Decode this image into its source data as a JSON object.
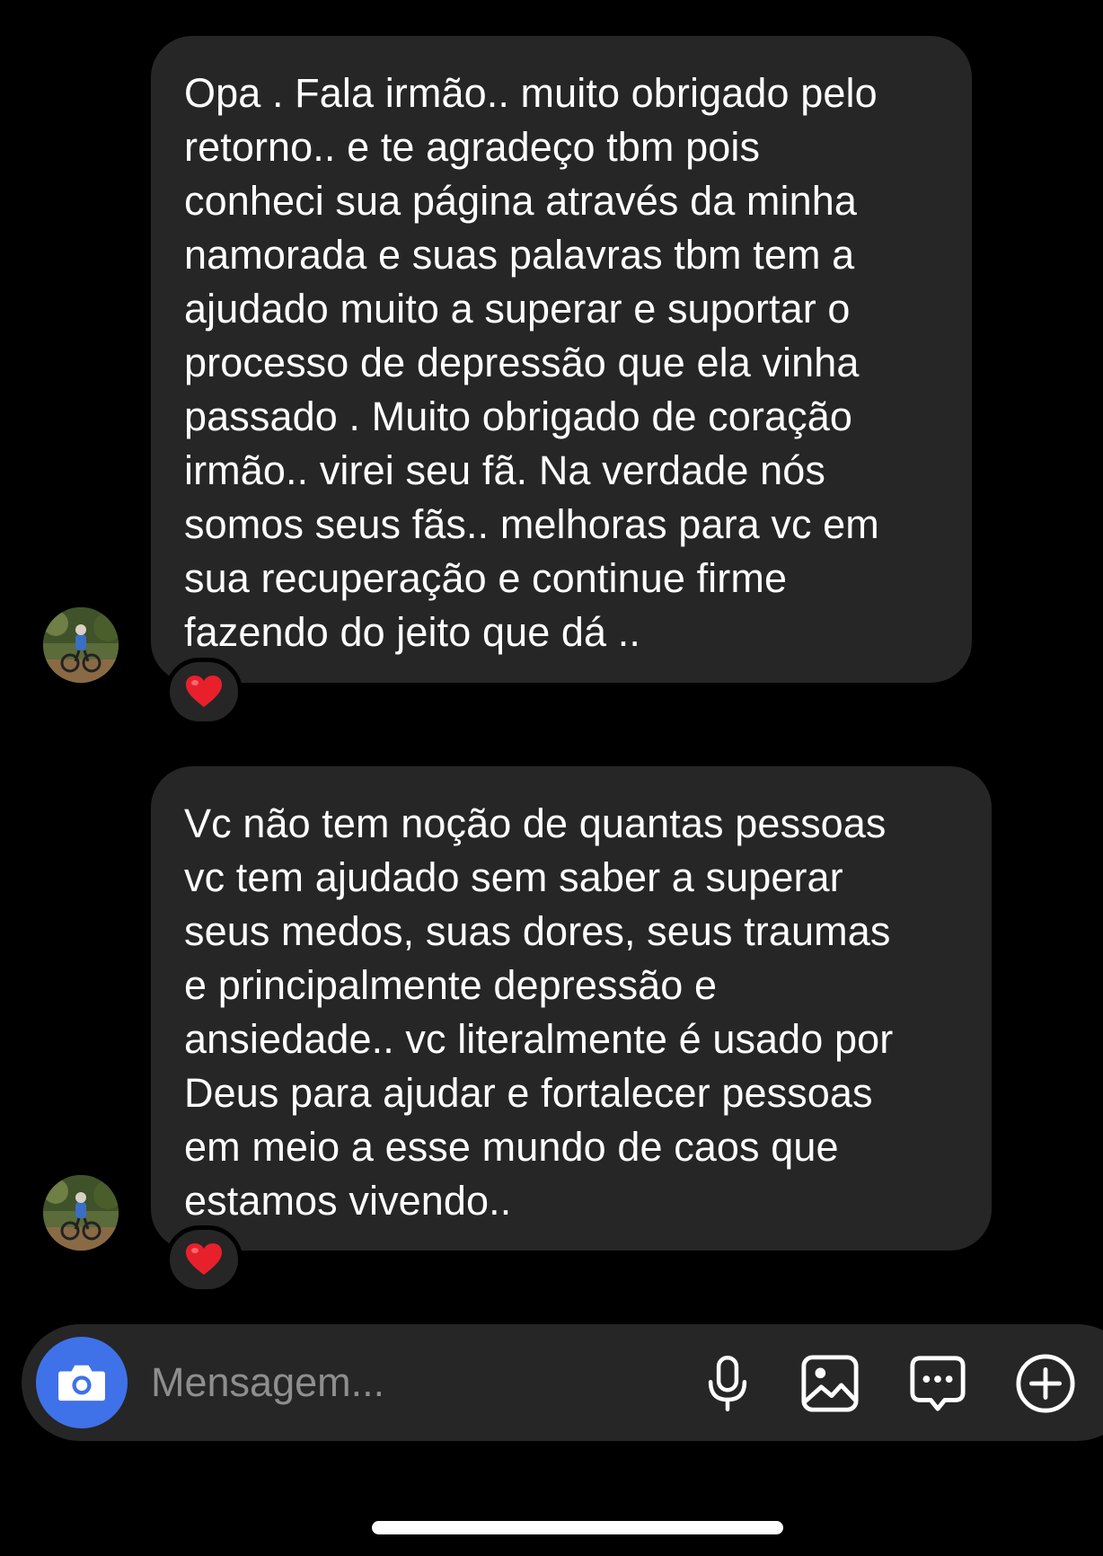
{
  "messages": [
    {
      "text": "Opa . Fala irmão.. muito obrigado pelo\nretorno.. e te agradeço tbm pois\nconheci sua página através da minha\nnamorada e suas palavras tbm tem a\najudado muito a superar e suportar o\nprocesso de depressão que ela vinha\npassado . Muito obrigado de coração\nirmão.. virei seu fã.  Na verdade nós\nsomos seus fãs.. melhoras para vc em\nsua recuperação e continue firme\nfazendo do jeito que dá ..",
      "reaction": "❤️"
    },
    {
      "text": "Vc não tem noção de quantas pessoas\nvc tem ajudado sem saber a superar\nseus medos, suas dores, seus traumas\ne principalmente depressão e\nansiedade.. vc literalmente é usado por\nDeus para ajudar e fortalecer pessoas\nem meio a esse mundo de caos que\nestamos vivendo..",
      "reaction": "❤️"
    }
  ],
  "composer": {
    "placeholder": "Mensagem...",
    "icons": [
      "camera-icon",
      "microphone-icon",
      "gallery-icon",
      "sticker-icon",
      "plus-icon"
    ]
  },
  "colors": {
    "background": "#000000",
    "bubble": "#262626",
    "camera_button": "#3f71e9",
    "placeholder": "#8e8e8e",
    "heart": "#e8202c"
  }
}
